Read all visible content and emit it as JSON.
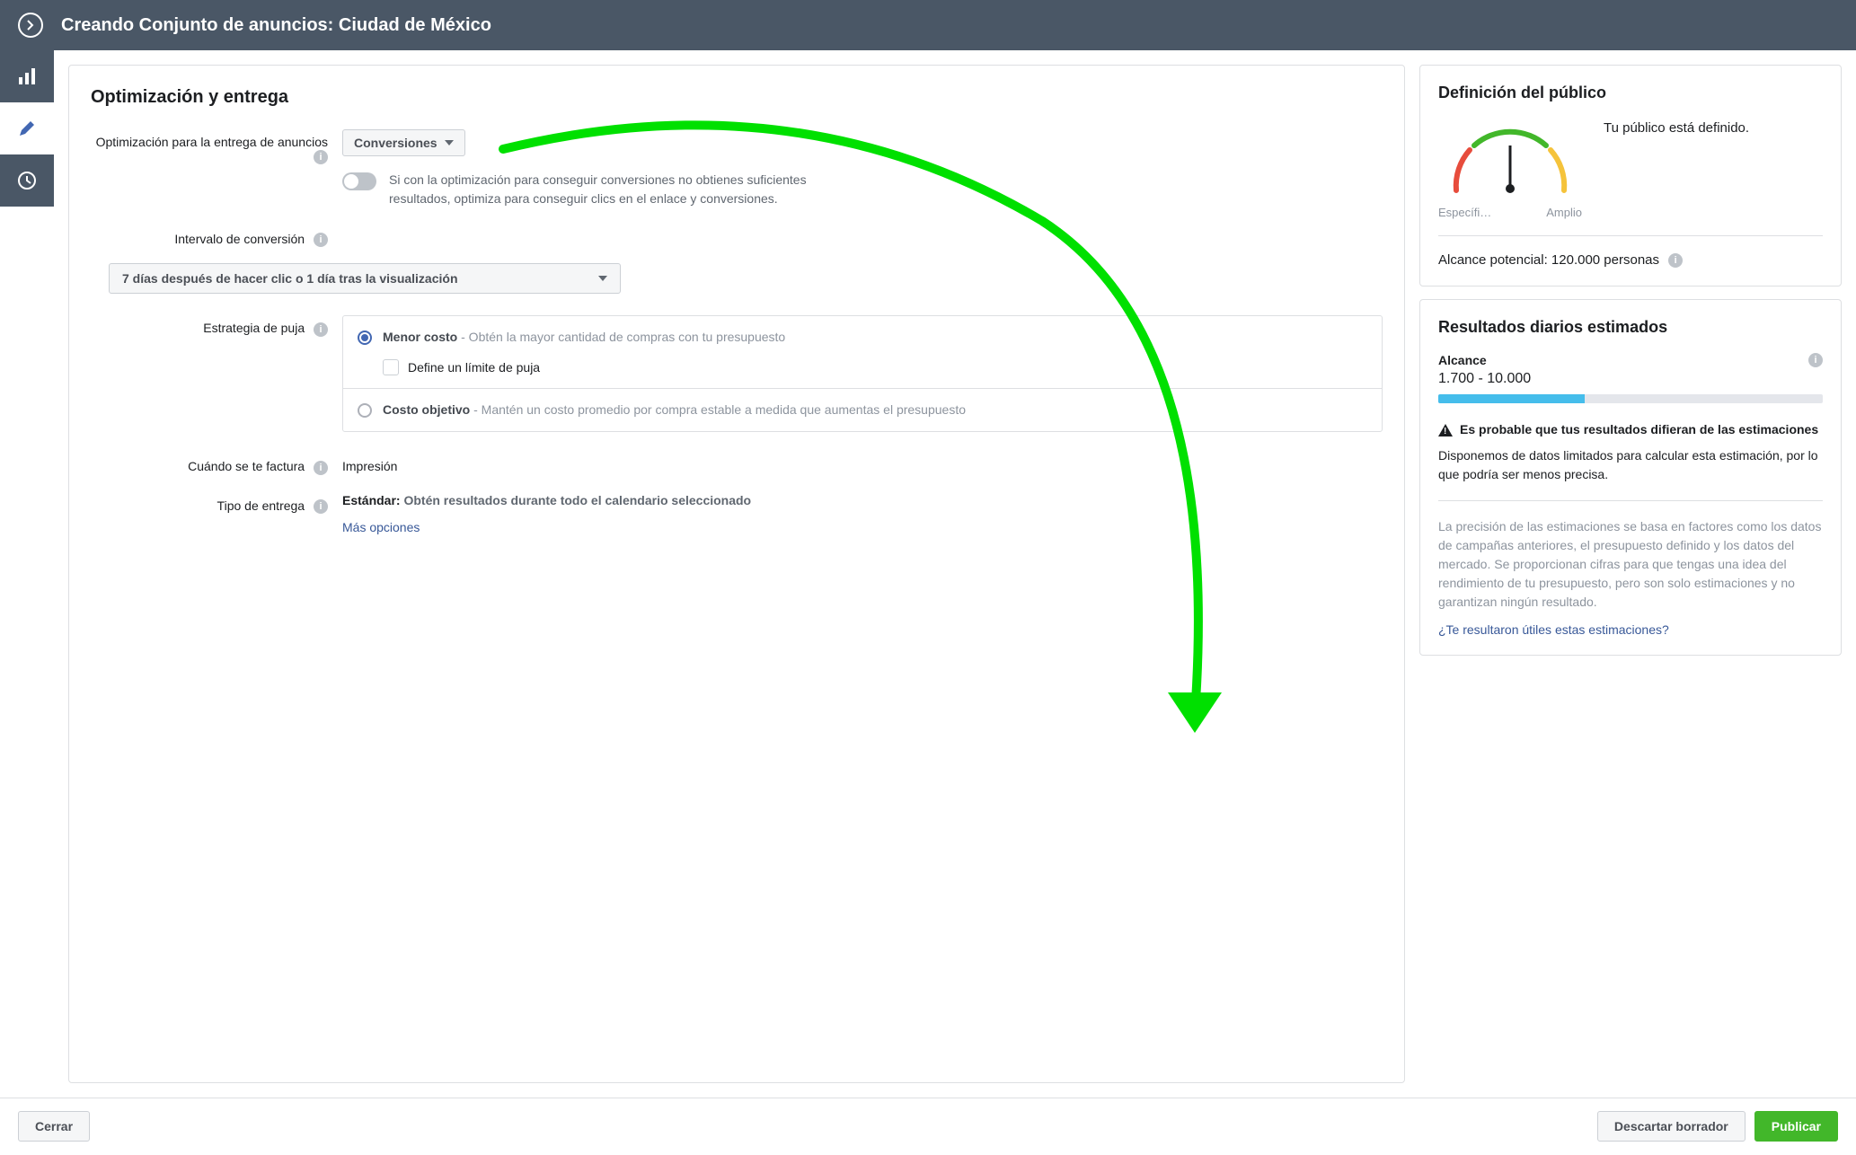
{
  "header": {
    "title": "Creando Conjunto de anuncios: Ciudad de México"
  },
  "main": {
    "section_title": "Optimización y entrega",
    "optimization": {
      "label": "Optimización para la entrega de anuncios",
      "dropdown_value": "Conversiones",
      "toggle_text": "Si con la optimización para conseguir conversiones no obtienes suficientes resultados, optimiza para conseguir clics en el enlace y conversiones."
    },
    "conversion_window": {
      "label": "Intervalo de conversión",
      "dropdown_value": "7 días después de hacer clic o 1 día tras la visualización"
    },
    "bid_strategy": {
      "label": "Estrategia de puja",
      "options": [
        {
          "title": "Menor costo",
          "desc": " - Obtén la mayor cantidad de compras con tu presupuesto",
          "checkbox_label": "Define un límite de puja"
        },
        {
          "title": "Costo objetivo",
          "desc": " - Mantén un costo promedio por compra estable a medida que aumentas el presupuesto"
        }
      ]
    },
    "billing": {
      "label": "Cuándo se te factura",
      "value": "Impresión"
    },
    "delivery_type": {
      "label": "Tipo de entrega",
      "value_strong": "Estándar: ",
      "value_desc": "Obtén resultados durante todo el calendario seleccionado",
      "more_link": "Más opciones"
    }
  },
  "audience_card": {
    "title": "Definición del público",
    "gauge": {
      "left": "Específi…",
      "right": "Amplio"
    },
    "status": "Tu público está definido.",
    "reach_label": "Alcance potencial: ",
    "reach_value": "120.000 personas"
  },
  "results_card": {
    "title": "Resultados diarios estimados",
    "reach": {
      "label": "Alcance",
      "value": "1.700 - 10.000"
    },
    "warning": {
      "title": "Es probable que tus resultados difieran de las estimaciones",
      "desc": "Disponemos de datos limitados para calcular esta estimación, por lo que podría ser menos precisa."
    },
    "disclaimer": "La precisión de las estimaciones se basa en factores como los datos de campañas anteriores, el presupuesto definido y los datos del mercado. Se proporcionan cifras para que tengas una idea del rendimiento de tu presupuesto, pero son solo estimaciones y no garantizan ningún resultado.",
    "feedback_link": "¿Te resultaron útiles estas estimaciones?"
  },
  "footer": {
    "close": "Cerrar",
    "discard": "Descartar borrador",
    "publish": "Publicar"
  }
}
